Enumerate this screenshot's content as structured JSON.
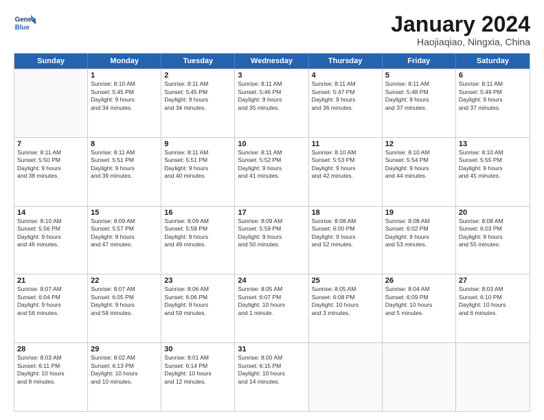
{
  "logo": {
    "line1": "General",
    "line2": "Blue"
  },
  "title": "January 2024",
  "subtitle": "Haojiaqiao, Ningxia, China",
  "weekdays": [
    "Sunday",
    "Monday",
    "Tuesday",
    "Wednesday",
    "Thursday",
    "Friday",
    "Saturday"
  ],
  "rows": [
    [
      {
        "num": "",
        "info": ""
      },
      {
        "num": "1",
        "info": "Sunrise: 8:10 AM\nSunset: 5:45 PM\nDaylight: 9 hours\nand 34 minutes."
      },
      {
        "num": "2",
        "info": "Sunrise: 8:11 AM\nSunset: 5:45 PM\nDaylight: 9 hours\nand 34 minutes."
      },
      {
        "num": "3",
        "info": "Sunrise: 8:11 AM\nSunset: 5:46 PM\nDaylight: 9 hours\nand 35 minutes."
      },
      {
        "num": "4",
        "info": "Sunrise: 8:11 AM\nSunset: 5:47 PM\nDaylight: 9 hours\nand 36 minutes."
      },
      {
        "num": "5",
        "info": "Sunrise: 8:11 AM\nSunset: 5:48 PM\nDaylight: 9 hours\nand 37 minutes."
      },
      {
        "num": "6",
        "info": "Sunrise: 8:11 AM\nSunset: 5:49 PM\nDaylight: 9 hours\nand 37 minutes."
      }
    ],
    [
      {
        "num": "7",
        "info": "Sunrise: 8:11 AM\nSunset: 5:50 PM\nDaylight: 9 hours\nand 38 minutes."
      },
      {
        "num": "8",
        "info": "Sunrise: 8:11 AM\nSunset: 5:51 PM\nDaylight: 9 hours\nand 39 minutes."
      },
      {
        "num": "9",
        "info": "Sunrise: 8:11 AM\nSunset: 5:51 PM\nDaylight: 9 hours\nand 40 minutes."
      },
      {
        "num": "10",
        "info": "Sunrise: 8:11 AM\nSunset: 5:52 PM\nDaylight: 9 hours\nand 41 minutes."
      },
      {
        "num": "11",
        "info": "Sunrise: 8:10 AM\nSunset: 5:53 PM\nDaylight: 9 hours\nand 42 minutes."
      },
      {
        "num": "12",
        "info": "Sunrise: 8:10 AM\nSunset: 5:54 PM\nDaylight: 9 hours\nand 44 minutes."
      },
      {
        "num": "13",
        "info": "Sunrise: 8:10 AM\nSunset: 5:55 PM\nDaylight: 9 hours\nand 45 minutes."
      }
    ],
    [
      {
        "num": "14",
        "info": "Sunrise: 8:10 AM\nSunset: 5:56 PM\nDaylight: 9 hours\nand 46 minutes."
      },
      {
        "num": "15",
        "info": "Sunrise: 8:09 AM\nSunset: 5:57 PM\nDaylight: 9 hours\nand 47 minutes."
      },
      {
        "num": "16",
        "info": "Sunrise: 8:09 AM\nSunset: 5:58 PM\nDaylight: 9 hours\nand 49 minutes."
      },
      {
        "num": "17",
        "info": "Sunrise: 8:09 AM\nSunset: 5:59 PM\nDaylight: 9 hours\nand 50 minutes."
      },
      {
        "num": "18",
        "info": "Sunrise: 8:08 AM\nSunset: 6:00 PM\nDaylight: 9 hours\nand 52 minutes."
      },
      {
        "num": "19",
        "info": "Sunrise: 8:08 AM\nSunset: 6:02 PM\nDaylight: 9 hours\nand 53 minutes."
      },
      {
        "num": "20",
        "info": "Sunrise: 8:08 AM\nSunset: 6:03 PM\nDaylight: 9 hours\nand 55 minutes."
      }
    ],
    [
      {
        "num": "21",
        "info": "Sunrise: 8:07 AM\nSunset: 6:04 PM\nDaylight: 9 hours\nand 56 minutes."
      },
      {
        "num": "22",
        "info": "Sunrise: 8:07 AM\nSunset: 6:05 PM\nDaylight: 9 hours\nand 58 minutes."
      },
      {
        "num": "23",
        "info": "Sunrise: 8:06 AM\nSunset: 6:06 PM\nDaylight: 9 hours\nand 59 minutes."
      },
      {
        "num": "24",
        "info": "Sunrise: 8:05 AM\nSunset: 6:07 PM\nDaylight: 10 hours\nand 1 minute."
      },
      {
        "num": "25",
        "info": "Sunrise: 8:05 AM\nSunset: 6:08 PM\nDaylight: 10 hours\nand 3 minutes."
      },
      {
        "num": "26",
        "info": "Sunrise: 8:04 AM\nSunset: 6:09 PM\nDaylight: 10 hours\nand 5 minutes."
      },
      {
        "num": "27",
        "info": "Sunrise: 8:03 AM\nSunset: 6:10 PM\nDaylight: 10 hours\nand 6 minutes."
      }
    ],
    [
      {
        "num": "28",
        "info": "Sunrise: 8:03 AM\nSunset: 6:11 PM\nDaylight: 10 hours\nand 8 minutes."
      },
      {
        "num": "29",
        "info": "Sunrise: 8:02 AM\nSunset: 6:13 PM\nDaylight: 10 hours\nand 10 minutes."
      },
      {
        "num": "30",
        "info": "Sunrise: 8:01 AM\nSunset: 6:14 PM\nDaylight: 10 hours\nand 12 minutes."
      },
      {
        "num": "31",
        "info": "Sunrise: 8:00 AM\nSunset: 6:15 PM\nDaylight: 10 hours\nand 14 minutes."
      },
      {
        "num": "",
        "info": ""
      },
      {
        "num": "",
        "info": ""
      },
      {
        "num": "",
        "info": ""
      }
    ]
  ]
}
